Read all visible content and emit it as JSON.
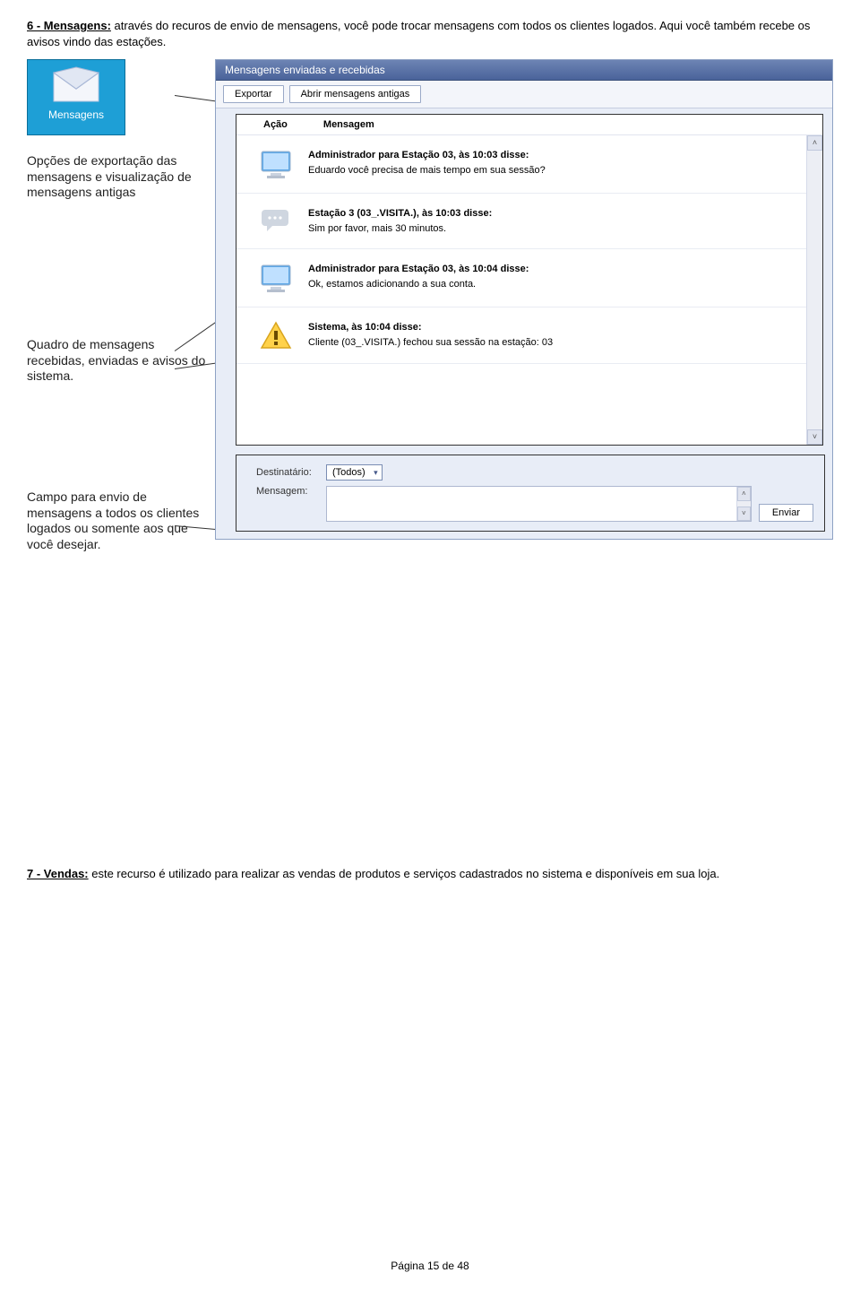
{
  "section6": {
    "heading": "6 - Mensagens:",
    "body": " através do recuros de envio de mensagens, você pode trocar mensagens com todos os clientes logados. Aqui você também recebe os avisos vindo das estações."
  },
  "sidebar": {
    "card_label": "Mensagens",
    "annot_export": "Opções de exportação das mensagens e visualização de mensagens antigas",
    "annot_board": "Quadro de mensagens recebidas, enviadas e avisos do sistema.",
    "annot_send": "Campo para envio de mensagens a todos os clientes logados ou somente aos que você desejar."
  },
  "panel": {
    "title": "Mensagens enviadas e recebidas",
    "btn_export": "Exportar",
    "btn_old": "Abrir mensagens antigas",
    "col_action": "Ação",
    "col_message": "Mensagem",
    "rows": [
      {
        "type": "monitor",
        "header": "Administrador para Estação 03, às 10:03 disse:",
        "body": "Eduardo você precisa de mais tempo em sua sessão?"
      },
      {
        "type": "bubble",
        "header": "Estação 3 (03_.VISITA.), às 10:03 disse:",
        "body": "Sim por favor, mais 30 minutos."
      },
      {
        "type": "monitor",
        "header": "Administrador para Estação 03, às 10:04 disse:",
        "body": "Ok, estamos adicionando a sua conta."
      },
      {
        "type": "warn",
        "header": "Sistema, às 10:04 disse:",
        "body": "Cliente (03_.VISITA.) fechou sua sessão na estação: 03"
      }
    ],
    "scroll_up": "˄",
    "scroll_down": "˅"
  },
  "send": {
    "dest_label": "Destinatário:",
    "dest_value": "(Todos)",
    "msg_label": "Mensagem:",
    "send_btn": "Enviar"
  },
  "section7": {
    "heading": "7 - Vendas:",
    "body": " este recurso é utilizado para realizar as vendas de produtos e serviços cadastrados no sistema e disponíveis em sua loja."
  },
  "footer": "Página 15 de 48"
}
